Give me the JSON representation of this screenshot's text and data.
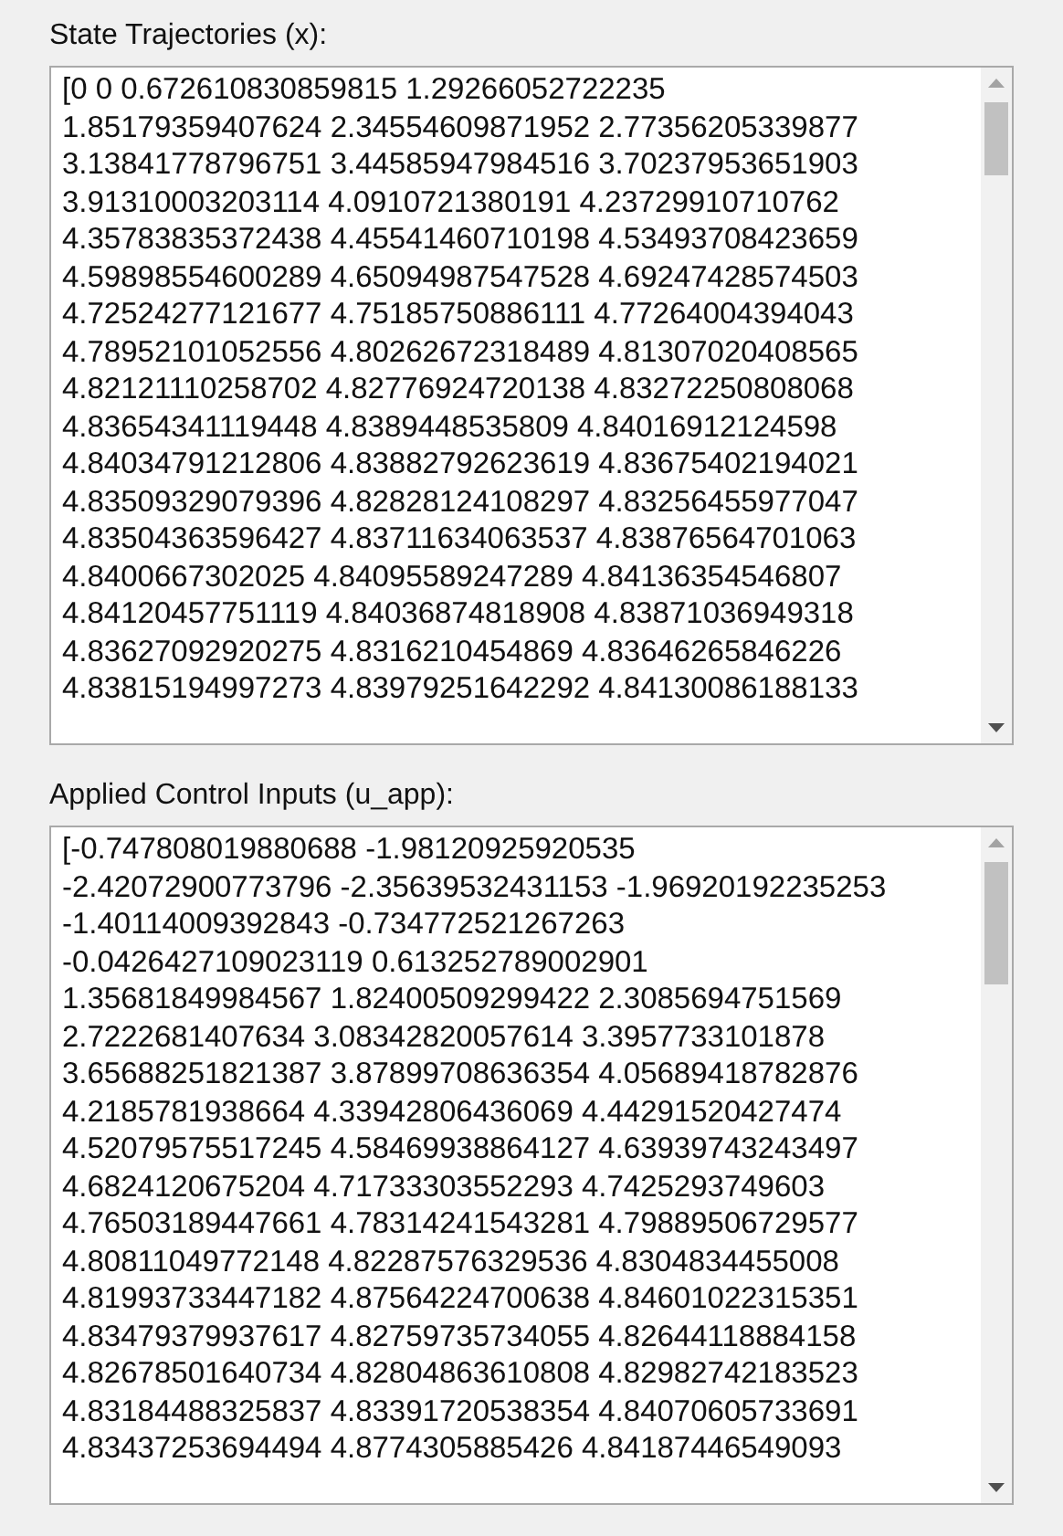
{
  "panels": [
    {
      "label": "State Trajectories (x):",
      "lines": [
        "[0 0 0.672610830859815 1.29266052722235",
        "1.85179359407624 2.34554609871952 2.77356205339877",
        "3.13841778796751 3.44585947984516 3.70237953651903",
        "3.91310003203114 4.0910721380191 4.23729910710762",
        "4.35783835372438 4.45541460710198 4.53493708423659",
        "4.59898554600289 4.65094987547528 4.69247428574503",
        "4.72524277121677 4.75185750886111 4.77264004394043",
        "4.78952101052556 4.80262672318489 4.81307020408565",
        "4.82121110258702 4.82776924720138 4.83272250808068",
        "4.83654341119448 4.8389448535809 4.84016912124598",
        "4.84034791212806 4.83882792623619 4.83675402194021",
        "4.83509329079396 4.82828124108297 4.83256455977047",
        "4.83504363596427 4.83711634063537 4.83876564701063",
        "4.8400667302025 4.84095589247289 4.84136354546807",
        "4.84120457751119 4.84036874818908 4.83871036949318",
        "4.83627092920275 4.8316210454869 4.83646265846226",
        "4.83815194997273 4.83979251642292 4.84130086188133"
      ]
    },
    {
      "label": "Applied Control Inputs (u_app):",
      "lines": [
        "[-0.747808019880688 -1.98120925920535",
        "-2.42072900773796 -2.35639532431153 -1.96920192235253",
        "-1.40114009392843 -0.734772521267263",
        "-0.0426427109023119 0.613252789002901",
        "1.35681849984567 1.82400509299422 2.3085694751569",
        "2.7222681407634 3.08342820057614 3.3957733101878",
        "3.65688251821387 3.87899708636354 4.05689418782876",
        "4.2185781938664 4.33942806436069 4.44291520427474",
        "4.52079575517245 4.58469938864127 4.63939743243497",
        "4.6824120675204 4.71733303552293 4.7425293749603",
        "4.76503189447661 4.78314241543281 4.79889506729577",
        "4.80811049772148 4.82287576329536 4.8304834455008",
        "4.81993733447182 4.87564224700638 4.84601022315351",
        "4.83479379937617 4.82759735734055 4.82644118884158",
        "4.82678501640734 4.82804863610808 4.82982742183523",
        "4.83184488325837 4.83391720538354 4.84070605733691",
        "4.83437253694494 4.8774305885426 4.84187446549093"
      ]
    }
  ]
}
